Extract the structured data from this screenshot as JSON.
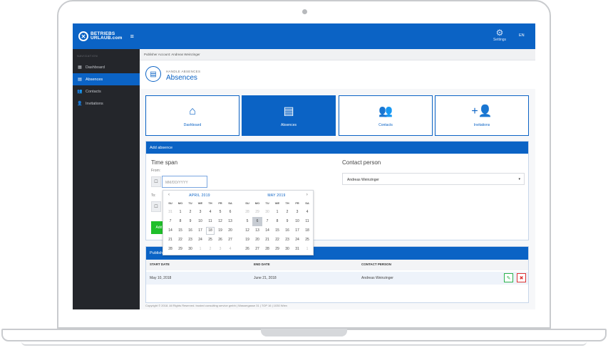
{
  "sidebar": {
    "logo_top": "BETRIEBS",
    "logo_bottom": "URLAUB.com",
    "nav_title": "NAVIGATION",
    "items": [
      {
        "label": "Dashboard",
        "icon": "dashboard-icon"
      },
      {
        "label": "Absences",
        "icon": "calendar-icon"
      },
      {
        "label": "Contacts",
        "icon": "contacts-icon"
      },
      {
        "label": "Invitations",
        "icon": "invite-icon"
      }
    ]
  },
  "topbar": {
    "settings_label": "Settings",
    "lang": "EN"
  },
  "breadcrumb": "Publisher Account: Andreas Weinzinger",
  "page": {
    "subtitle": "HANDLE ABSENCES",
    "title": "Absences"
  },
  "tiles": [
    {
      "label": "Dashboard",
      "icon": "home-icon"
    },
    {
      "label": "Absences",
      "icon": "calendar-icon"
    },
    {
      "label": "Contacts",
      "icon": "contacts-icon"
    },
    {
      "label": "Invitations",
      "icon": "add-user-icon"
    }
  ],
  "add_absence": {
    "header": "Add absence",
    "time_span": "Time span",
    "from_label": "From:",
    "to_label": "To:",
    "date_placeholder": "MM/DD/YYYY",
    "add_button": "Add",
    "contact_title": "Contact person",
    "contact_value": "Andreas Weinzinger"
  },
  "datepicker": {
    "weekdays": [
      "SU",
      "MO",
      "TU",
      "WE",
      "TH",
      "FR",
      "SA"
    ],
    "months": [
      {
        "title": "APRIL 2019",
        "days": [
          "31",
          "1",
          "2",
          "3",
          "4",
          "5",
          "6",
          "7",
          "8",
          "9",
          "10",
          "11",
          "12",
          "13",
          "14",
          "15",
          "16",
          "17",
          "18",
          "19",
          "20",
          "21",
          "22",
          "23",
          "24",
          "25",
          "26",
          "27",
          "28",
          "29",
          "30",
          "1",
          "2",
          "3",
          "4"
        ],
        "muted": [
          0,
          31,
          32,
          33,
          34
        ],
        "today": 18
      },
      {
        "title": "MAY 2019",
        "days": [
          "28",
          "29",
          "30",
          "1",
          "2",
          "3",
          "4",
          "5",
          "6",
          "7",
          "8",
          "9",
          "10",
          "11",
          "12",
          "13",
          "14",
          "15",
          "16",
          "17",
          "18",
          "19",
          "20",
          "21",
          "22",
          "23",
          "24",
          "25",
          "26",
          "27",
          "28",
          "29",
          "30",
          "31",
          "1"
        ],
        "muted": [
          0,
          1,
          2,
          34
        ],
        "selected": 8
      }
    ]
  },
  "table": {
    "header": "Published absences",
    "columns": [
      "START DATE",
      "END DATE",
      "CONTACT PERSON"
    ],
    "rows": [
      {
        "start": "May 10, 2018",
        "end": "June 21, 2018",
        "contact": "Andreas Weinzinger"
      }
    ]
  },
  "footer": "Copyright © 2018. All Rights Reserved. trusted consulting service gmbh | Wassergasse 31 | TOP 16 | 1030 Wien"
}
